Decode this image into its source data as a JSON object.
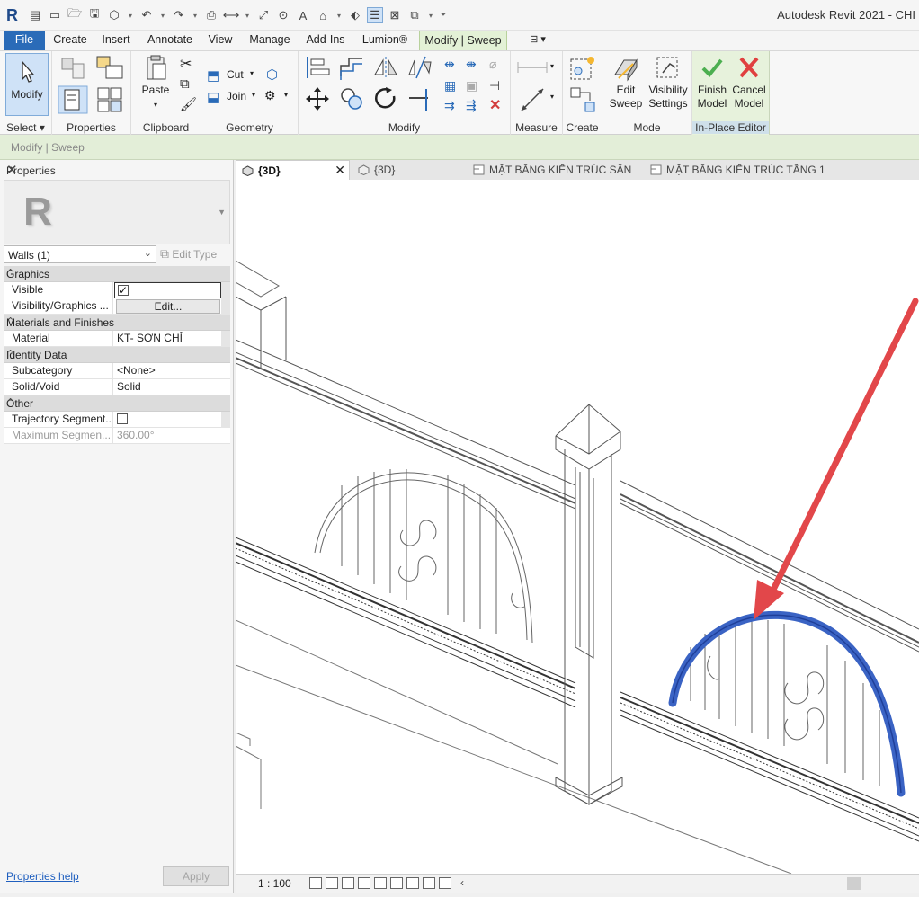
{
  "window": {
    "title": "Autodesk Revit 2021 - CHI"
  },
  "ribbon_tabs": [
    "File",
    "Create",
    "Insert",
    "Annotate",
    "View",
    "Manage",
    "Add-Ins",
    "Lumion®",
    "Modify | Sweep"
  ],
  "ribbon": {
    "select_label": "Select ▾",
    "modify_label": "Modify",
    "properties_label": "Properties",
    "paste_label": "Paste",
    "clipboard_label": "Clipboard",
    "cut_label": "Cut",
    "join_label": "Join",
    "geometry_label": "Geometry",
    "modify_panel_label": "Modify",
    "measure_label": "Measure",
    "create_label": "Create",
    "edit_sweep_label_1": "Edit",
    "edit_sweep_label_2": "Sweep",
    "visibility_label_1": "Visibility",
    "visibility_label_2": "Settings",
    "mode_label": "Mode",
    "finish_label_1": "Finish",
    "finish_label_2": "Model",
    "cancel_label_1": "Cancel",
    "cancel_label_2": "Model",
    "inplace_label": "In-Place Editor"
  },
  "context_bar": "Modify | Sweep",
  "properties": {
    "title": "Properties",
    "type_selector": "Walls (1)",
    "edit_type": "Edit Type",
    "groups": [
      {
        "name": "Graphics",
        "rows": [
          {
            "key": "Visible",
            "value": "",
            "checkbox": true,
            "checked": true
          },
          {
            "key": "Visibility/Graphics ...",
            "value": "Edit...",
            "button": true
          }
        ]
      },
      {
        "name": "Materials and Finishes",
        "rows": [
          {
            "key": "Material",
            "value": "KT- SƠN CHỈ"
          }
        ]
      },
      {
        "name": "Identity Data",
        "rows": [
          {
            "key": "Subcategory",
            "value": "<None>"
          },
          {
            "key": "Solid/Void",
            "value": "Solid"
          }
        ]
      },
      {
        "name": "Other",
        "rows": [
          {
            "key": "Trajectory Segment...",
            "value": "",
            "checkbox": true,
            "checked": false
          },
          {
            "key": "Maximum Segmen...",
            "value": "360.00°",
            "disabled": true
          }
        ]
      }
    ],
    "help_link": "Properties help",
    "apply_label": "Apply"
  },
  "view_tabs": [
    {
      "label": "{3D}",
      "active": true,
      "icon": "3d-view-icon"
    },
    {
      "label": "{3D}",
      "active": false,
      "icon": "3d-view-icon"
    },
    {
      "label": "MẶT BẰNG KIẾN TRÚC SÂN",
      "active": false,
      "icon": "floor-plan-icon"
    },
    {
      "label": "MẶT BẰNG KIẾN TRÚC TẦNG 1",
      "active": false,
      "icon": "floor-plan-icon"
    }
  ],
  "view_bar": {
    "scale": "1 : 100",
    "more": "‹"
  },
  "colors": {
    "accent": "#2a6bb8",
    "selection": "#3a63c4",
    "annotation_arrow": "#e2474a",
    "context_tab": "#e3f1d6"
  }
}
